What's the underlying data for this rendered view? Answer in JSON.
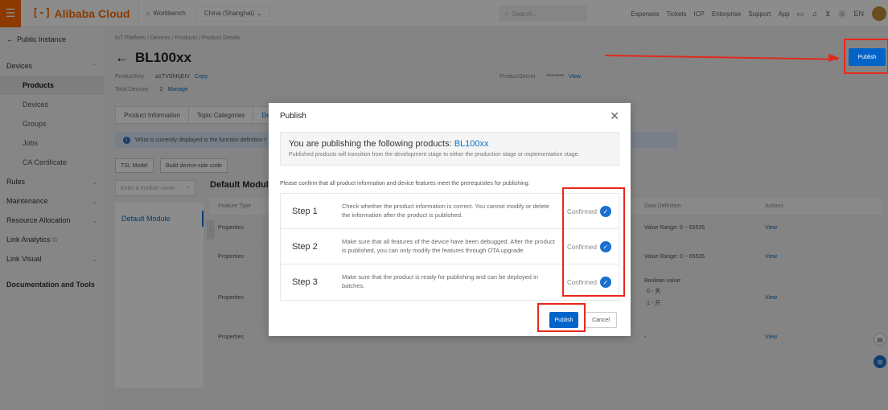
{
  "topbar": {
    "brand": "Alibaba Cloud",
    "brand_mark": "[-]",
    "workbench": "Workbench",
    "region": "China (Shanghai)",
    "search_placeholder": "Search...",
    "links": [
      "Expenses",
      "Tickets",
      "ICP",
      "Enterprise",
      "Support",
      "App"
    ],
    "lang": "EN"
  },
  "sidebar": {
    "back": "Public Instance",
    "sections": [
      {
        "label": "Devices",
        "children": [
          "Products",
          "Devices",
          "Groups",
          "Jobs",
          "CA Certificate"
        ]
      },
      {
        "label": "Rules"
      },
      {
        "label": "Maintenance"
      },
      {
        "label": "Resource Allocation"
      },
      {
        "label": "Link Analytics"
      },
      {
        "label": "Link Visual"
      },
      {
        "label": "Documentation and Tools"
      }
    ],
    "active": "Products"
  },
  "main": {
    "breadcrumb": "IoT Platform  /  Devices  /  Products  /  Product Details",
    "title": "BL100xx",
    "product_key_label": "ProductKey",
    "product_key": "a1TVShKjEIV",
    "copy": "Copy",
    "total_devices_label": "Total Devices",
    "total_devices": "2",
    "manage": "Manage",
    "product_secret_label": "ProductSecret",
    "product_secret": "********",
    "view": "View",
    "publish": "Publish",
    "tabs": [
      "Product Information",
      "Topic Categories",
      "De"
    ],
    "info": "What is currently displayed is the function definition t",
    "tsl_model": "TSL Model",
    "build_sdk": "Build device-side code",
    "module_search_placeholder": "Enter a module name",
    "module_title": "Default Module",
    "module_item": "Default Module",
    "table_headers": [
      "Feature Type",
      "Data Definition",
      "Actions"
    ],
    "rows": [
      {
        "type": "Properties",
        "def": "Value Range: 0 ~ 65535",
        "action": "View"
      },
      {
        "type": "Properties",
        "def": "Value Range: 0 ~ 65535",
        "action": "View"
      },
      {
        "type": "Properties",
        "def": "Boolean value:",
        "bool0": "0 - 关",
        "bool1": "1 - 开",
        "action": "View"
      },
      {
        "type": "Properties",
        "def": "-",
        "action": "View"
      }
    ]
  },
  "dialog": {
    "title": "Publish",
    "heading_prefix": "You are publishing the following products: ",
    "heading_product": "BL100xx",
    "subtext": "Published products will transition from the development stage to either the production stage or implementation stage.",
    "note": "Please confirm that all product information and device features meet the prerequisites for publishing:",
    "steps": [
      {
        "name": "Step 1",
        "desc": "Check whether the product information is correct. You cannot modify or delete the information after the product is published.",
        "status": "Confirmed"
      },
      {
        "name": "Step 2",
        "desc": "Make sure that all features of the device have been debugged. After the product is published, you can only modify the features through OTA upgrade.",
        "status": "Confirmed"
      },
      {
        "name": "Step 3",
        "desc": "Make sure that the product is ready for publishing and can be deployed in batches.",
        "status": "Confirmed"
      }
    ],
    "publish": "Publish",
    "cancel": "Cancel"
  },
  "colors": {
    "brand": "#ff6a00",
    "primary": "#0064c8",
    "highlight": "#e8281b"
  }
}
